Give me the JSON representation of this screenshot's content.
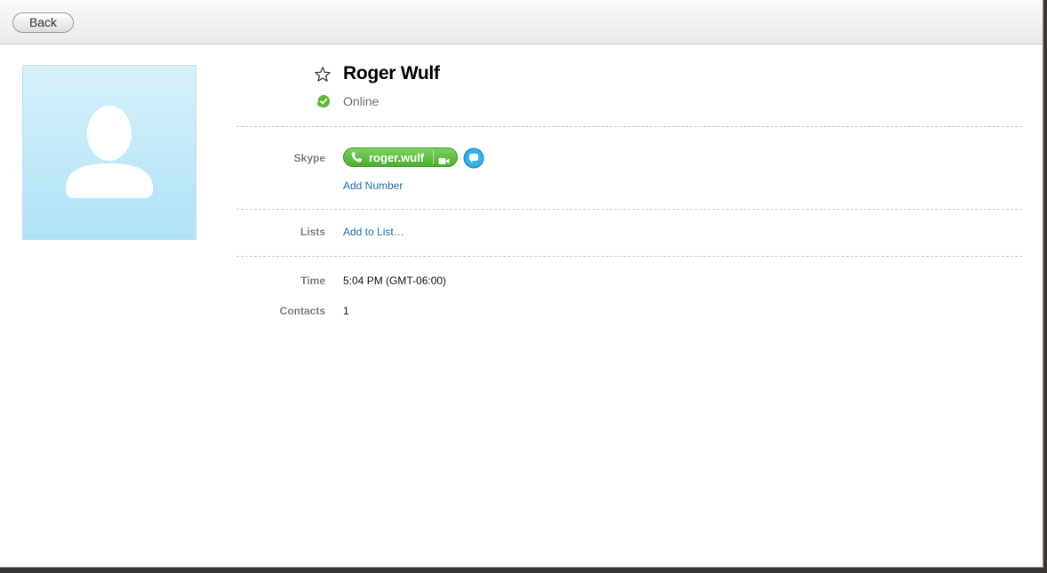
{
  "toolbar": {
    "back_label": "Back"
  },
  "contact": {
    "name": "Roger Wulf",
    "status": "Online",
    "status_color": "#5fb832"
  },
  "skype": {
    "label": "Skype",
    "username": "roger.wulf",
    "add_number": "Add Number"
  },
  "lists": {
    "label": "Lists",
    "add_to_list": "Add to List…"
  },
  "details": {
    "time_label": "Time",
    "time_value": "5:04 PM (GMT-06:00)",
    "contacts_label": "Contacts",
    "contacts_value": "1"
  },
  "icons": {
    "favorite": "star-outline-icon",
    "status": "online-status-icon",
    "call": "phone-icon",
    "video": "video-camera-icon",
    "chat": "chat-bubble-icon"
  },
  "colors": {
    "call_green": "#49b12b",
    "chat_blue": "#2ea7e0",
    "link_blue": "#1e6ca8",
    "avatar_bg": "#c4eaf8"
  }
}
